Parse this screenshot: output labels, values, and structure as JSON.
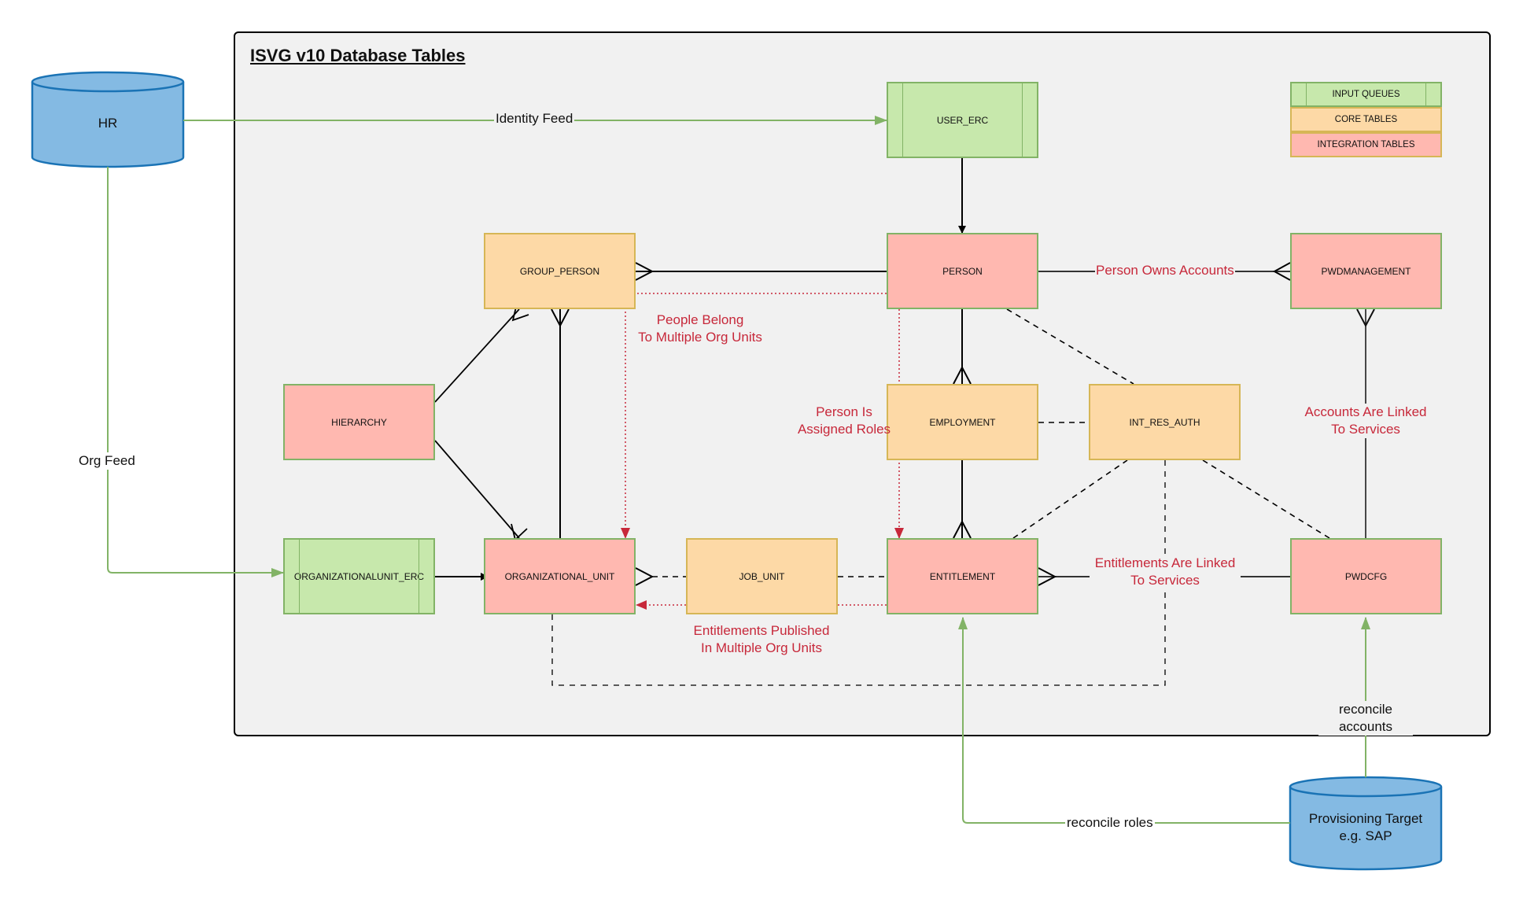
{
  "title": "ISVG v10 Database Tables",
  "external_sources": {
    "hr": "HR",
    "provisioning_target_line1": "Provisioning Target",
    "provisioning_target_line2": "e.g. SAP"
  },
  "legend": {
    "input_queues": "INPUT QUEUES",
    "core_tables": "CORE TABLES",
    "integration_tables": "INTEGRATION TABLES"
  },
  "tables": {
    "user_erc": "USER_ERC",
    "group_person": "GROUP_PERSON",
    "person": "PERSON",
    "pwdmanagement": "PWDMANAGEMENT",
    "hierarchy": "HIERARCHY",
    "employment": "EMPLOYMENT",
    "int_res_auth": "INT_RES_AUTH",
    "organizationalunit_erc": "ORGANIZATIONALUNIT_ERC",
    "organizational_unit": "ORGANIZATIONAL_UNIT",
    "job_unit": "JOB_UNIT",
    "entitlement": "ENTITLEMENT",
    "pwdcfg": "PWDCFG"
  },
  "edge_labels": {
    "identity_feed": "Identity Feed",
    "org_feed": "Org Feed",
    "person_owns_accounts": "Person Owns Accounts",
    "people_belong_1": "People Belong",
    "people_belong_2": "To Multiple Org Units",
    "person_assigned_1": "Person Is",
    "person_assigned_2": "Assigned Roles",
    "accounts_linked_1": "Accounts Are Linked",
    "accounts_linked_2": "To Services",
    "entitlements_linked_1": "Entitlements Are Linked",
    "entitlements_linked_2": "To Services",
    "entitlements_published_1": "Entitlements Published",
    "entitlements_published_2": "In Multiple Org Units",
    "reconcile_accounts": "reconcile accounts",
    "reconcile_roles": "reconcile roles"
  },
  "colors": {
    "input_fill": "#c7e8ac",
    "input_border": "#82b366",
    "core_fill": "#fdd9a6",
    "core_border": "#d6b656",
    "integration_fill": "#ffb8b0",
    "cylinder_fill": "#84bae3",
    "cylinder_border": "#1a73b5",
    "feed_line": "#82b366",
    "annotation_red": "#c7283a"
  }
}
